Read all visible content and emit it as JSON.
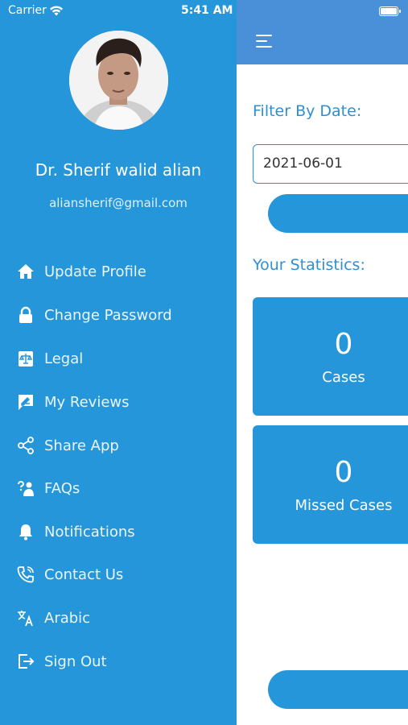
{
  "status_bar": {
    "carrier": "Carrier",
    "time": "5:41 AM"
  },
  "profile": {
    "name": "Dr. Sherif walid alian",
    "email": "aliansherif@gmail.com"
  },
  "menu": [
    {
      "label": "Update Profile",
      "icon": "home-icon"
    },
    {
      "label": "Change Password",
      "icon": "lock-icon"
    },
    {
      "label": "Legal",
      "icon": "legal-icon"
    },
    {
      "label": "My Reviews",
      "icon": "reviews-icon"
    },
    {
      "label": "Share App",
      "icon": "share-icon"
    },
    {
      "label": "FAQs",
      "icon": "faq-icon"
    },
    {
      "label": "Notifications",
      "icon": "bell-icon"
    },
    {
      "label": "Contact Us",
      "icon": "phone-icon"
    },
    {
      "label": "Arabic",
      "icon": "translate-icon"
    },
    {
      "label": "Sign Out",
      "icon": "sign-out-icon"
    }
  ],
  "main": {
    "filter_title": "Filter By Date:",
    "date_value": "2021-06-01",
    "stats_title": "Your Statistics:",
    "stats": [
      {
        "value": "0",
        "label": "Cases"
      },
      {
        "value": "0",
        "label": "Missed Cases"
      }
    ]
  },
  "colors": {
    "drawer_bg": "#2596d9",
    "header_bg": "#4a90d9",
    "accent": "#2f8fd0"
  }
}
